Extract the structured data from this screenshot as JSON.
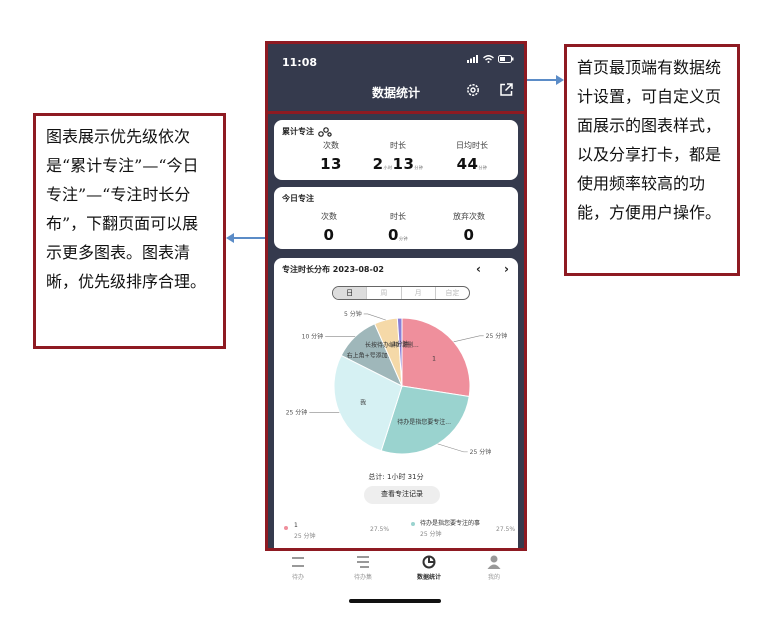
{
  "annotations": {
    "left": "图表展示优先级依次是“累计专注”—“今日专注”—“专注时长分布”，下翻页面可以展示更多图表。图表清晰，优先级排序合理。",
    "right": "首页最顶端有数据统计设置，可自定义页面展示的图表样式，以及分享打卡，都是使用频率较高的功能，方便用户操作。"
  },
  "status": {
    "time": "11:08"
  },
  "nav": {
    "title": "数据统计"
  },
  "icons": {
    "gear": "gear-icon",
    "share": "share-icon",
    "signal": "signal-icon",
    "wifi": "wifi-icon",
    "battery": "battery-icon"
  },
  "cumulative": {
    "title": "累计专注",
    "count_label": "次数",
    "count": "13",
    "duration_label": "时长",
    "duration_h": "2",
    "duration_h_unit": "小时",
    "duration_m": "13",
    "duration_m_unit": "分钟",
    "avg_label": "日均时长",
    "avg": "44",
    "avg_unit": "分钟"
  },
  "today": {
    "title": "今日专注",
    "count_label": "次数",
    "count": "0",
    "duration_label": "时长",
    "duration": "0",
    "duration_unit": "分钟",
    "abandon_label": "放弃次数",
    "abandon": "0"
  },
  "distribution": {
    "title": "专注时长分布 2023-08-02",
    "prev": "‹",
    "next": "›",
    "tabs": [
      "日",
      "周",
      "月",
      "自定"
    ],
    "total": "总计: 1小时 31分",
    "view_button": "查看专注记录",
    "legend": [
      {
        "name": "1",
        "sub": "25 分钟",
        "pct": "27.5%",
        "color": "#ef8f9c"
      },
      {
        "name": "待办是指您要专注的事",
        "sub": "25 分钟",
        "pct": "27.5%",
        "color": "#9ad3cf"
      }
    ]
  },
  "chart_data": {
    "type": "pie",
    "slices": [
      {
        "label": "1",
        "value": 25,
        "value_label": "25 分钟",
        "color": "#ef8f9c"
      },
      {
        "label": "待办是指您要专注...",
        "value": 25,
        "value_label": "25 分钟",
        "color": "#9ad3cf"
      },
      {
        "label": "我",
        "value": 25,
        "value_label": "25 分钟",
        "color": "#d6f1f3"
      },
      {
        "label": "右上角+号添加待...",
        "value": 10,
        "value_label": "10 分钟",
        "color": "#9fb7ba"
      },
      {
        "label": "长按待办编辑或删...",
        "value": 5,
        "value_label": "5 分钟",
        "color": "#f5d9a8"
      },
      {
        "label": "1分钟",
        "value": 1,
        "value_label": "",
        "color": "#8a7fd6"
      }
    ]
  },
  "tabbar": [
    {
      "label": "待办",
      "icon": "list-icon"
    },
    {
      "label": "待办集",
      "icon": "collection-icon"
    },
    {
      "label": "数据统计",
      "icon": "pie-chart-icon"
    },
    {
      "label": "我的",
      "icon": "person-icon"
    }
  ]
}
